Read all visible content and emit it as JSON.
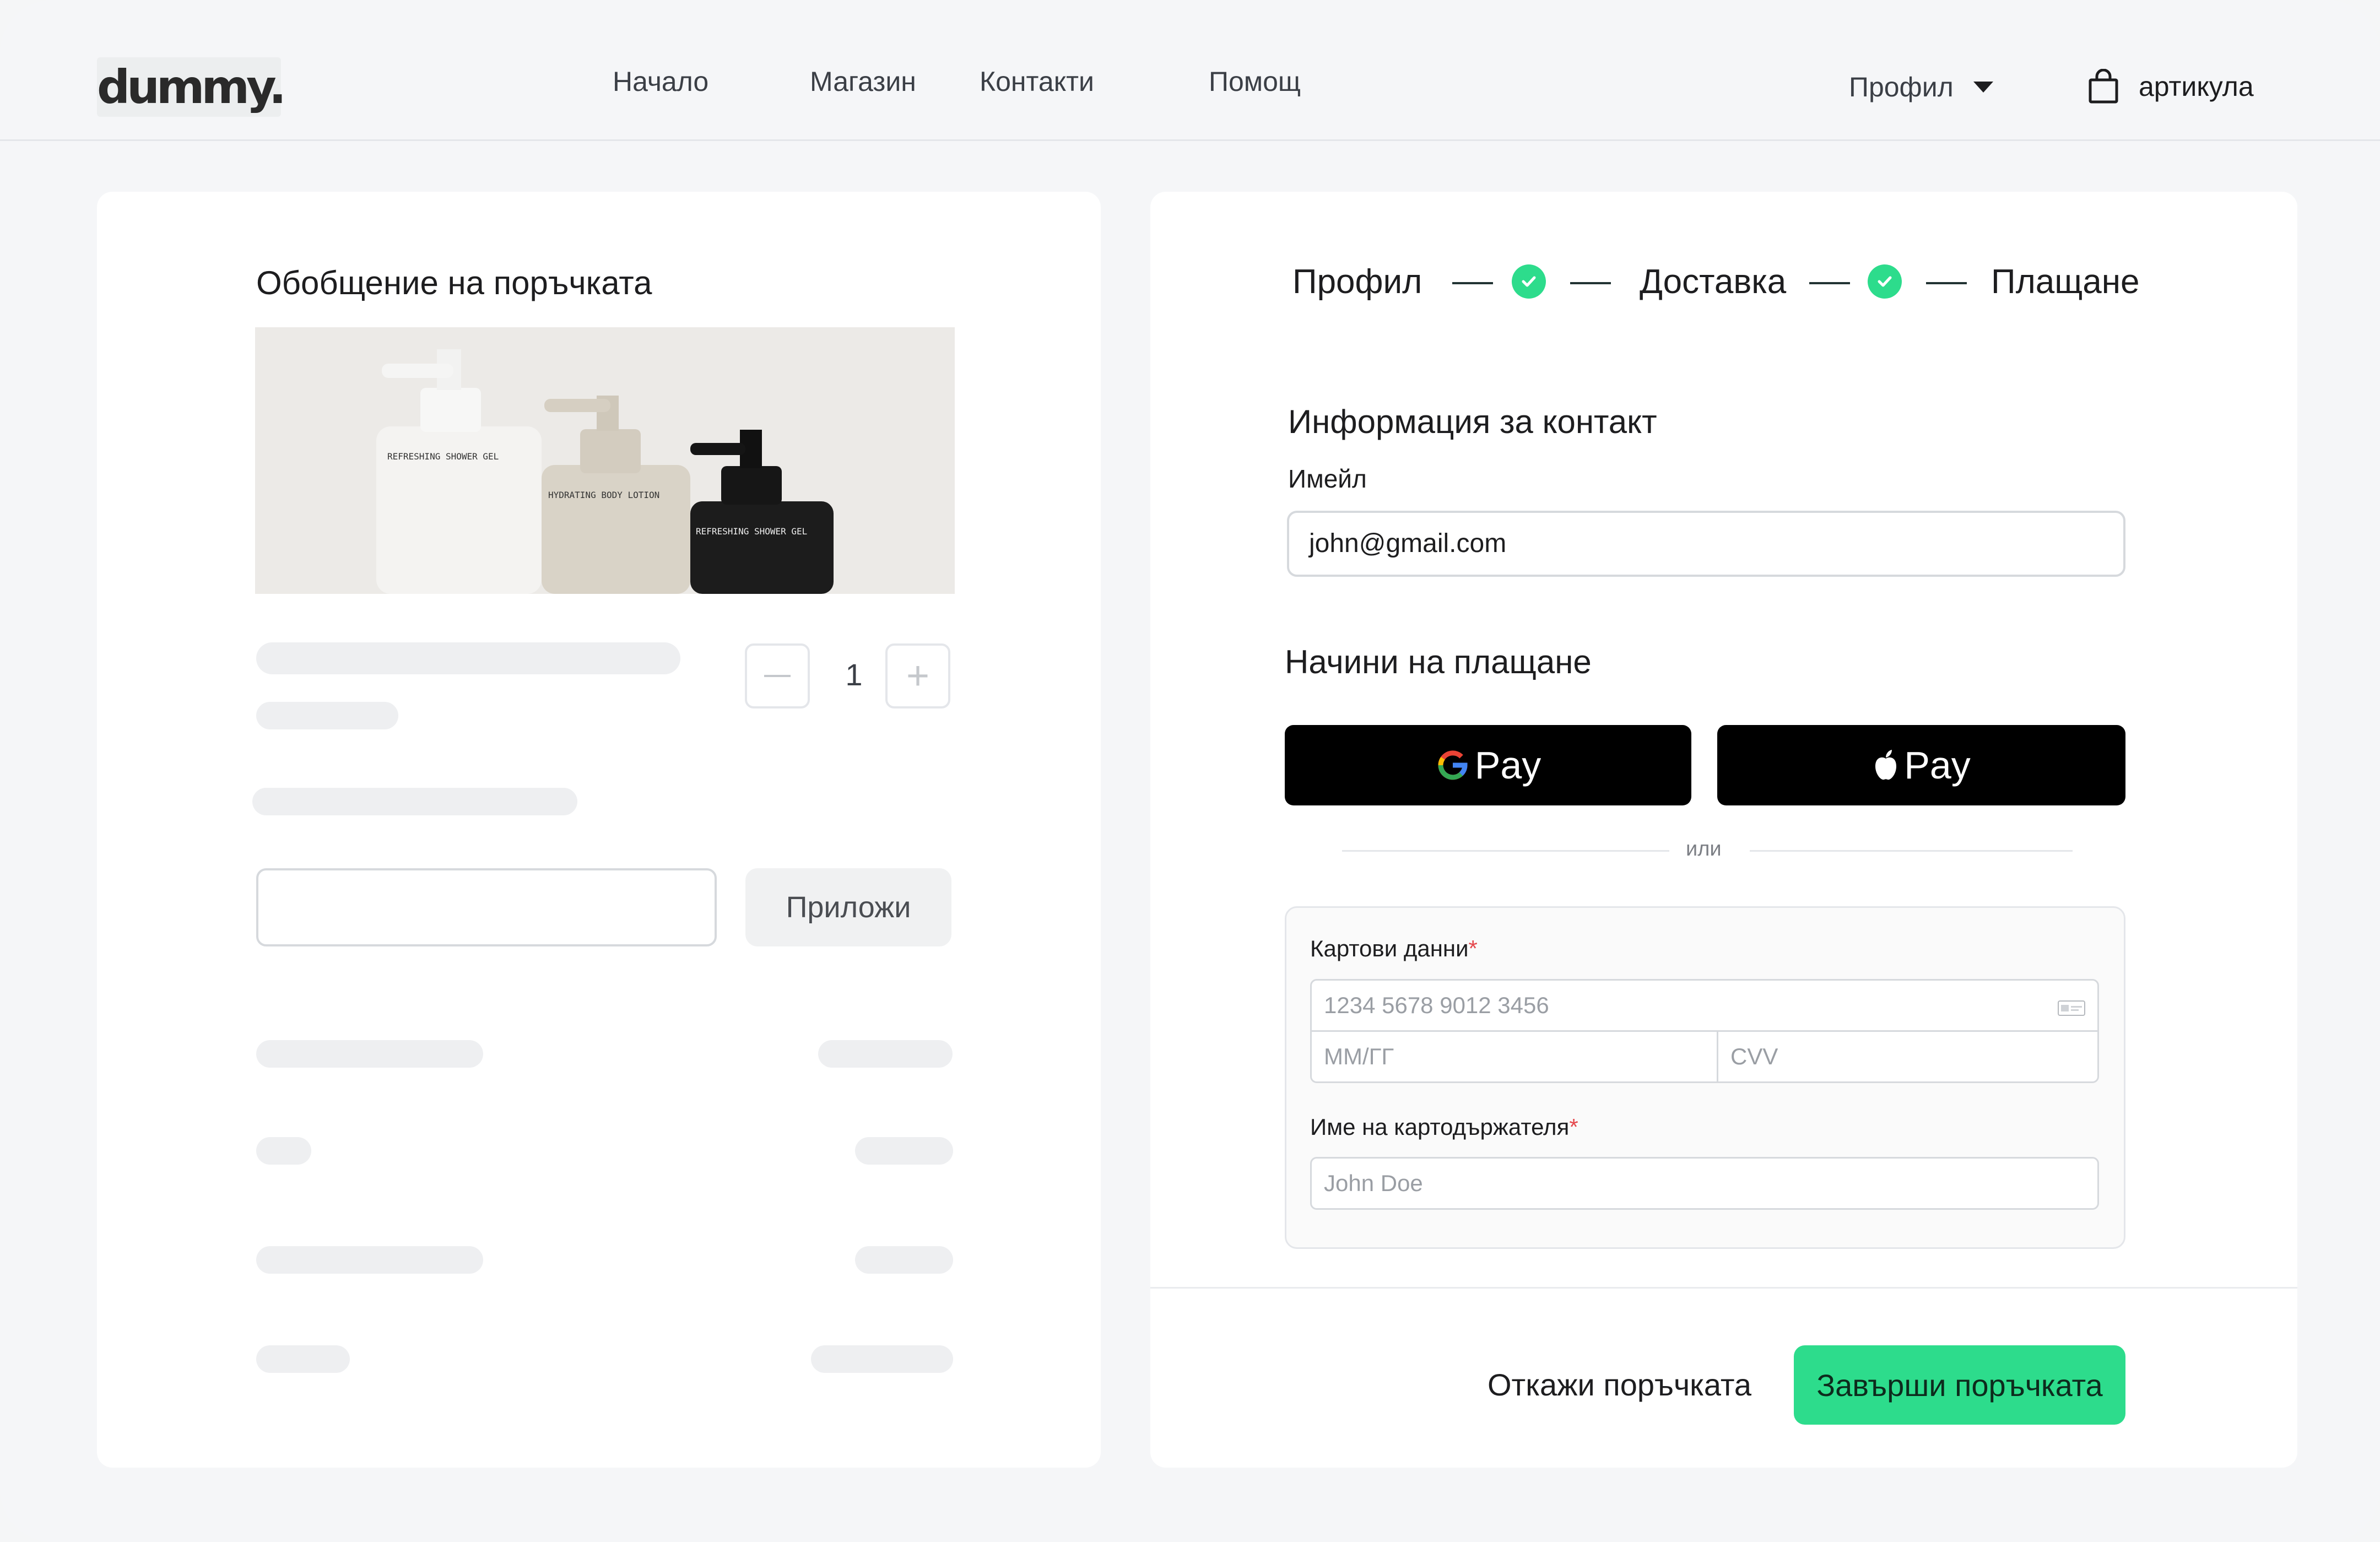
{
  "header": {
    "logo": "dummy.",
    "nav": [
      "Начало",
      "Магазин",
      "Контакти",
      "Помощ"
    ],
    "profile_label": "Профил",
    "cart_label": "артикула"
  },
  "summary": {
    "title": "Обобщение на поръчката",
    "product_labels": [
      "REFRESHING SHOWER GEL",
      "HYDRATING BODY LOTION",
      "REFRESHING SHOWER GEL"
    ],
    "quantity": "1",
    "apply_label": "Приложи"
  },
  "stepper": {
    "steps": [
      "Профил",
      "Доставка",
      "Плащане"
    ]
  },
  "contact": {
    "title": "Информация за контакт",
    "email_label": "Имейл",
    "email_value": "john@gmail.com"
  },
  "payment": {
    "title": "Начини на плащане",
    "gpay_label": "Pay",
    "applepay_label": "Pay",
    "or_text": "или",
    "card_label": "Картови данни",
    "required_mark": "*",
    "card_number_placeholder": "1234 5678 9012 3456",
    "expiry_placeholder": "ММ/ГГ",
    "cvv_placeholder": "CVV",
    "holder_label": "Име на картодържателя",
    "holder_placeholder": "John Doe"
  },
  "actions": {
    "cancel": "Откажи поръчката",
    "complete": "Завърши поръчката"
  },
  "colors": {
    "accent": "#2ddc8c",
    "required": "#e5484d",
    "pay_button": "#000000"
  }
}
